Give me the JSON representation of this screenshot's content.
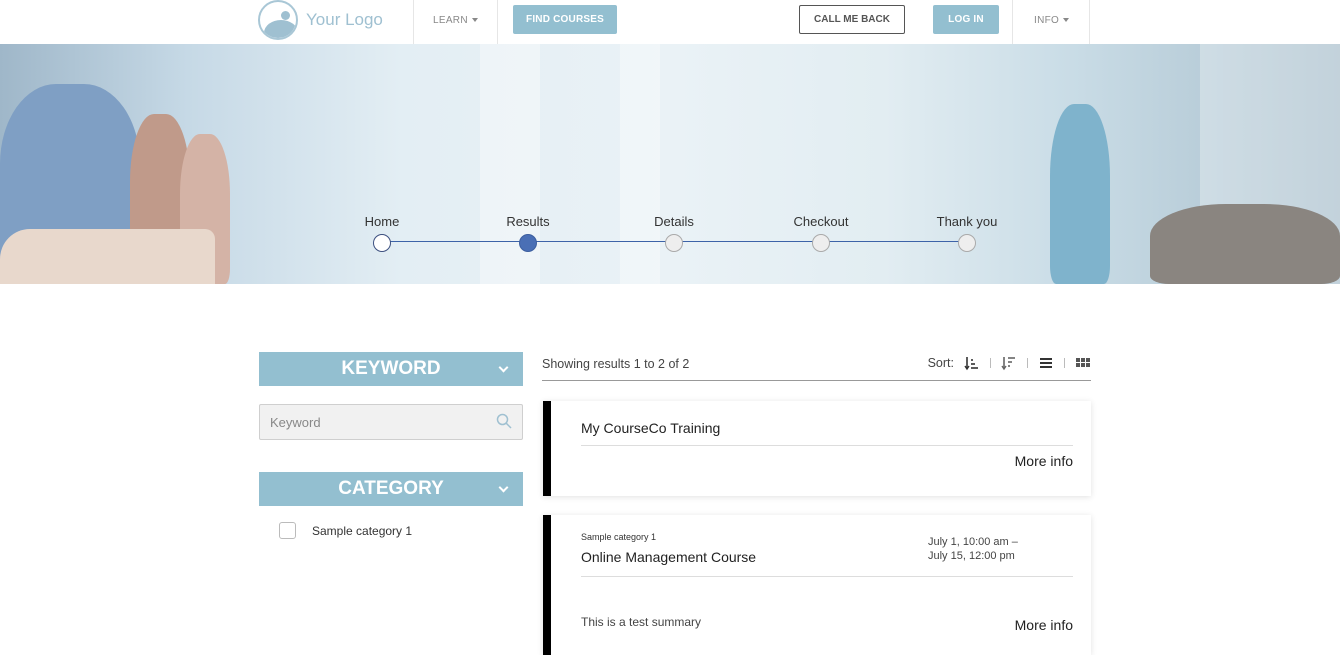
{
  "header": {
    "logo_text": "Your Logo",
    "learn_label": "LEARN",
    "find_courses_label": "FIND COURSES",
    "call_me_back_label": "CALL ME BACK",
    "log_in_label": "LOG IN",
    "info_label": "INFO"
  },
  "progress": {
    "steps": [
      {
        "label": "Home",
        "state": "done"
      },
      {
        "label": "Results",
        "state": "active"
      },
      {
        "label": "Details",
        "state": "pending"
      },
      {
        "label": "Checkout",
        "state": "pending"
      },
      {
        "label": "Thank you",
        "state": "pending"
      }
    ]
  },
  "sidebar": {
    "keyword_heading": "KEYWORD",
    "keyword_placeholder": "Keyword",
    "category_heading": "CATEGORY",
    "categories": [
      "Sample category 1"
    ]
  },
  "results": {
    "count_text": "Showing results 1 to 2 of 2",
    "sort_label": "Sort:",
    "items": [
      {
        "title": "My CourseCo Training",
        "more": "More info"
      },
      {
        "category": "Sample category 1",
        "title": "Online Management Course",
        "date_line1": "July 1, 10:00 am –",
        "date_line2": "July 15, 12:00 pm",
        "summary": "This is a test summary",
        "more": "More info"
      }
    ]
  },
  "colors": {
    "accent": "#93bfd0",
    "step_active": "#4a6fb5",
    "card_border": "#000000"
  }
}
